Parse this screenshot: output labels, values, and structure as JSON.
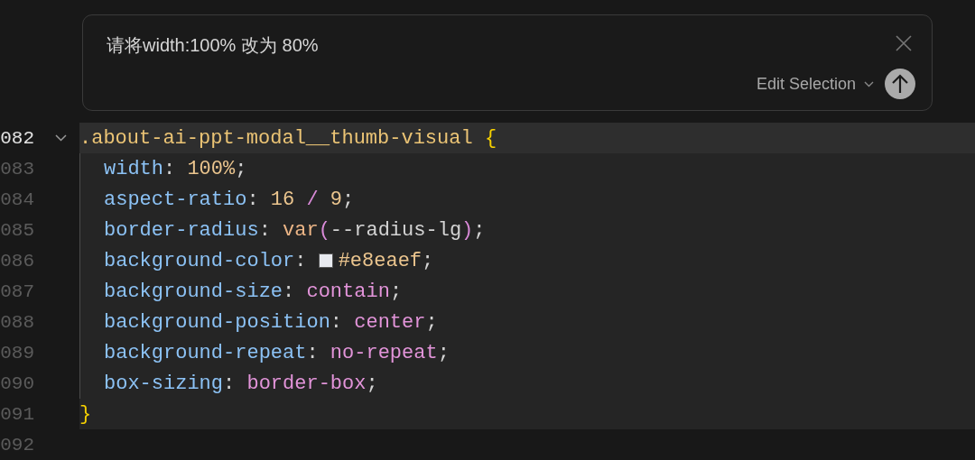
{
  "prompt": {
    "text": "请将width:100% 改为 80%",
    "mode": "Edit Selection"
  },
  "lines": [
    {
      "number": "082",
      "selected": true,
      "current": true,
      "expanded": true,
      "tokens": [
        {
          "kind": "selector",
          "text": ".about-ai-ppt-modal__thumb-visual "
        },
        {
          "kind": "brace",
          "text": "{"
        }
      ],
      "children": [
        {
          "number": "083",
          "selected": true,
          "current": false,
          "tokens": [
            {
              "kind": "property",
              "text": "width"
            },
            {
              "kind": "punct",
              "text": ": "
            },
            {
              "kind": "number",
              "text": "100%"
            },
            {
              "kind": "punct",
              "text": ";"
            }
          ]
        },
        {
          "number": "084",
          "selected": true,
          "current": false,
          "tokens": [
            {
              "kind": "property",
              "text": "aspect-ratio"
            },
            {
              "kind": "punct",
              "text": ": "
            },
            {
              "kind": "number",
              "text": "16 "
            },
            {
              "kind": "operator",
              "text": "/"
            },
            {
              "kind": "number",
              "text": " 9"
            },
            {
              "kind": "punct",
              "text": ";"
            }
          ]
        },
        {
          "number": "085",
          "selected": true,
          "current": false,
          "tokens": [
            {
              "kind": "property",
              "text": "border-radius"
            },
            {
              "kind": "punct",
              "text": ": "
            },
            {
              "kind": "function",
              "text": "var"
            },
            {
              "kind": "paren",
              "text": "("
            },
            {
              "kind": "plain",
              "text": "--radius-lg"
            },
            {
              "kind": "paren",
              "text": ")"
            },
            {
              "kind": "punct",
              "text": ";"
            }
          ]
        },
        {
          "number": "086",
          "selected": true,
          "current": false,
          "tokens": [
            {
              "kind": "property",
              "text": "background-color"
            },
            {
              "kind": "punct",
              "text": ": "
            },
            {
              "kind": "swatch",
              "color": "#e8eaef"
            },
            {
              "kind": "number",
              "text": "#e8eaef"
            },
            {
              "kind": "punct",
              "text": ";"
            }
          ]
        },
        {
          "number": "087",
          "selected": true,
          "current": false,
          "tokens": [
            {
              "kind": "property",
              "text": "background-size"
            },
            {
              "kind": "punct",
              "text": ": "
            },
            {
              "kind": "keyword",
              "text": "contain"
            },
            {
              "kind": "punct",
              "text": ";"
            }
          ]
        },
        {
          "number": "088",
          "selected": true,
          "current": false,
          "tokens": [
            {
              "kind": "property",
              "text": "background-position"
            },
            {
              "kind": "punct",
              "text": ": "
            },
            {
              "kind": "keyword",
              "text": "center"
            },
            {
              "kind": "punct",
              "text": ";"
            }
          ]
        },
        {
          "number": "089",
          "selected": true,
          "current": false,
          "tokens": [
            {
              "kind": "property",
              "text": "background-repeat"
            },
            {
              "kind": "punct",
              "text": ": "
            },
            {
              "kind": "keyword",
              "text": "no-repeat"
            },
            {
              "kind": "punct",
              "text": ";"
            }
          ]
        },
        {
          "number": "090",
          "selected": true,
          "current": false,
          "tokens": [
            {
              "kind": "property",
              "text": "box-sizing"
            },
            {
              "kind": "punct",
              "text": ": "
            },
            {
              "kind": "keyword",
              "text": "border-box"
            },
            {
              "kind": "punct",
              "text": ";"
            }
          ]
        }
      ]
    },
    {
      "number": "091",
      "selected": true,
      "current": false,
      "tokens": [
        {
          "kind": "brace",
          "text": "}"
        }
      ]
    },
    {
      "number": "092",
      "selected": false,
      "current": false
    }
  ]
}
